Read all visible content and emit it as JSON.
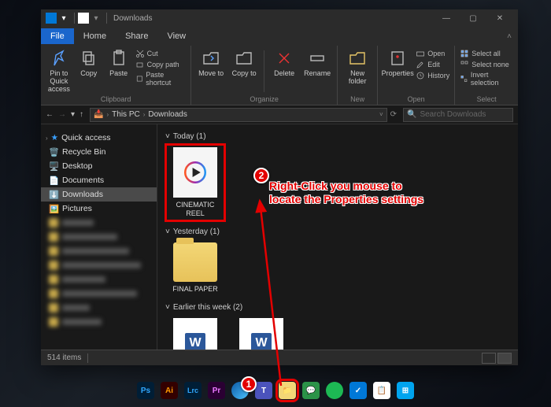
{
  "titlebar": {
    "app_title": "Downloads"
  },
  "win_controls": {
    "min": "—",
    "max": "▢",
    "close": "✕"
  },
  "tabs": {
    "file": "File",
    "home": "Home",
    "share": "Share",
    "view": "View"
  },
  "ribbon": {
    "pin": "Pin to Quick access",
    "copy": "Copy",
    "paste": "Paste",
    "cut": "Cut",
    "copy_path": "Copy path",
    "paste_shortcut": "Paste shortcut",
    "clipboard_label": "Clipboard",
    "move_to": "Move to",
    "copy_to": "Copy to",
    "delete": "Delete",
    "rename": "Rename",
    "organize_label": "Organize",
    "new_folder": "New folder",
    "new_label": "New",
    "properties": "Properties",
    "open": "Open",
    "edit": "Edit",
    "history": "History",
    "open_label": "Open",
    "select_all": "Select all",
    "select_none": "Select none",
    "invert": "Invert selection",
    "select_label": "Select"
  },
  "address": {
    "breadcrumbs": [
      "This PC",
      "Downloads"
    ],
    "search_placeholder": "Search Downloads"
  },
  "sidebar": {
    "quick_access": "Quick access",
    "items": [
      {
        "label": "Recycle Bin"
      },
      {
        "label": "Desktop"
      },
      {
        "label": "Documents"
      },
      {
        "label": "Downloads"
      },
      {
        "label": "Pictures"
      }
    ]
  },
  "groups": [
    {
      "header": "Today (1)",
      "items": [
        {
          "label": "CINEMATIC REEL",
          "kind": "video"
        }
      ]
    },
    {
      "header": "Yesterday (1)",
      "items": [
        {
          "label": "FINAL PAPER",
          "kind": "folder"
        }
      ]
    },
    {
      "header": "Earlier this week (2)",
      "items": [
        {
          "label": "",
          "kind": "docx"
        },
        {
          "label": "",
          "kind": "docx"
        }
      ]
    }
  ],
  "status": {
    "count": "514 items"
  },
  "annotations": {
    "badge1": "1",
    "badge2": "2",
    "text_l1": "Right-Click you mouse to",
    "text_l2": "locate the Properties settings"
  }
}
